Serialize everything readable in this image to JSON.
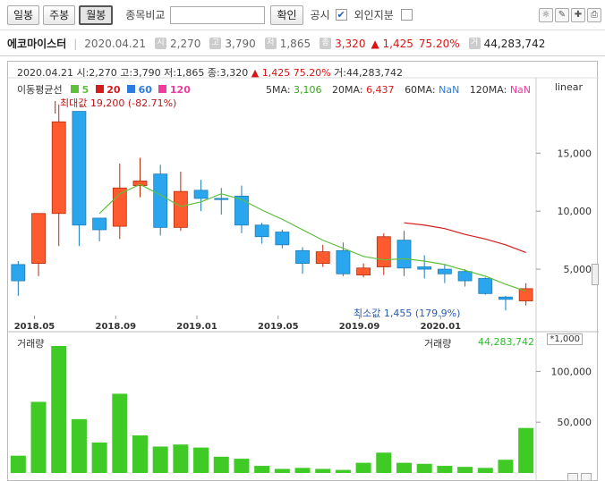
{
  "toolbar": {
    "period_daily": "일봉",
    "period_weekly": "주봉",
    "period_monthly": "월봉",
    "compare_label": "종목비교",
    "confirm_label": "확인",
    "disclosure_label": "공시",
    "foreign_label": "외인지분",
    "disclosure_check": "✔"
  },
  "info": {
    "name": "에코마이스터",
    "date": "2020.04.21",
    "open": "2,270",
    "high": "3,790",
    "low": "1,865",
    "close": "3,320",
    "change": "▲ 1,425",
    "change_pct": "75.20%",
    "volume": "44,283,742"
  },
  "chart_header": {
    "line1": "2020.04.21 시:2,270 고:3,790 저:1,865 종:3,320",
    "change": "▲ 1,425",
    "change_pct": "75.20%",
    "volume": "거:44,283,742",
    "ma_label": "이동평균선",
    "ma_items": [
      "5",
      "20",
      "60",
      "120"
    ],
    "ma_colors": [
      "#5fc03c",
      "#d51c1c",
      "#2d7be0",
      "#ee3b9c"
    ],
    "ma5": "3,106",
    "ma20": "6,437",
    "ma60": "NaN",
    "ma120": "NaN",
    "scale_mode": "linear",
    "max_label": "최대값 19,200 (-82.71%)",
    "min_label": "최소값 1,455 (179.9%)",
    "volume_label": "거래량",
    "volume_label2": "거래량",
    "volume_value": "44,283,742",
    "volume_scale": "*1,000"
  },
  "chart_data": {
    "type": "candlestick",
    "x_ticks": [
      "2018.05",
      "2018.09",
      "2019.01",
      "2019.05",
      "2019.09",
      "2020.01"
    ],
    "y_ticks": [
      5000,
      10000,
      15000
    ],
    "y_tick_labels": [
      "5,000",
      "10,000",
      "15,000"
    ],
    "ylim": [
      1000,
      19800
    ],
    "volume_ticks": [
      50000,
      100000
    ],
    "volume_tick_labels": [
      "50,000",
      "100,000"
    ],
    "volume_ylim": [
      0,
      125000
    ],
    "candles": [
      {
        "o": 5400,
        "h": 5700,
        "l": 2700,
        "c": 4000,
        "v": 17000
      },
      {
        "o": 5500,
        "h": 9800,
        "l": 4400,
        "c": 9800,
        "v": 70000
      },
      {
        "o": 9800,
        "h": 19200,
        "l": 7000,
        "c": 17700,
        "v": 125000
      },
      {
        "o": 18600,
        "h": 18600,
        "l": 7000,
        "c": 8800,
        "v": 53000
      },
      {
        "o": 9400,
        "h": 9400,
        "l": 7400,
        "c": 8400,
        "v": 30000
      },
      {
        "o": 8700,
        "h": 14100,
        "l": 7600,
        "c": 12000,
        "v": 78000
      },
      {
        "o": 12200,
        "h": 14600,
        "l": 11200,
        "c": 12600,
        "v": 37000
      },
      {
        "o": 13200,
        "h": 14000,
        "l": 7900,
        "c": 8600,
        "v": 26000
      },
      {
        "o": 8600,
        "h": 13400,
        "l": 8300,
        "c": 11700,
        "v": 28000
      },
      {
        "o": 11800,
        "h": 12700,
        "l": 10000,
        "c": 11100,
        "v": 25000
      },
      {
        "o": 11100,
        "h": 12000,
        "l": 9700,
        "c": 11000,
        "v": 16000
      },
      {
        "o": 11300,
        "h": 12200,
        "l": 8100,
        "c": 8800,
        "v": 14000
      },
      {
        "o": 8800,
        "h": 9000,
        "l": 7200,
        "c": 7800,
        "v": 7000
      },
      {
        "o": 8200,
        "h": 8400,
        "l": 6800,
        "c": 7100,
        "v": 4000
      },
      {
        "o": 6600,
        "h": 6900,
        "l": 4600,
        "c": 5500,
        "v": 5000
      },
      {
        "o": 5500,
        "h": 7100,
        "l": 5200,
        "c": 6500,
        "v": 4000
      },
      {
        "o": 6600,
        "h": 7300,
        "l": 4400,
        "c": 4600,
        "v": 3000
      },
      {
        "o": 4500,
        "h": 5500,
        "l": 4300,
        "c": 5100,
        "v": 10000
      },
      {
        "o": 5200,
        "h": 8100,
        "l": 4500,
        "c": 7800,
        "v": 20000
      },
      {
        "o": 7500,
        "h": 8300,
        "l": 4400,
        "c": 5100,
        "v": 10000
      },
      {
        "o": 5200,
        "h": 6200,
        "l": 4200,
        "c": 5000,
        "v": 9000
      },
      {
        "o": 5000,
        "h": 5400,
        "l": 3800,
        "c": 4600,
        "v": 7000
      },
      {
        "o": 4800,
        "h": 5000,
        "l": 3500,
        "c": 4000,
        "v": 6000
      },
      {
        "o": 4200,
        "h": 4300,
        "l": 2800,
        "c": 2900,
        "v": 5000
      },
      {
        "o": 2600,
        "h": 2700,
        "l": 1455,
        "c": 2400,
        "v": 13000
      },
      {
        "o": 2270,
        "h": 3790,
        "l": 1865,
        "c": 3320,
        "v": 44283
      }
    ],
    "ma5_line": [
      null,
      null,
      null,
      null,
      9800,
      11500,
      12300,
      11400,
      10400,
      10800,
      11500,
      11000,
      10100,
      9300,
      8400,
      7500,
      6800,
      6100,
      5800,
      5900,
      5700,
      5400,
      4900,
      4400,
      3700,
      3100
    ],
    "ma20_line": [
      null,
      null,
      null,
      null,
      null,
      null,
      null,
      null,
      null,
      null,
      null,
      null,
      null,
      null,
      null,
      null,
      null,
      null,
      null,
      9000,
      8800,
      8500,
      8000,
      7600,
      7100,
      6437
    ],
    "rise_color": "#ff5b2e",
    "fall_color": "#2aa6ee",
    "volume_color": "#3fca25"
  }
}
